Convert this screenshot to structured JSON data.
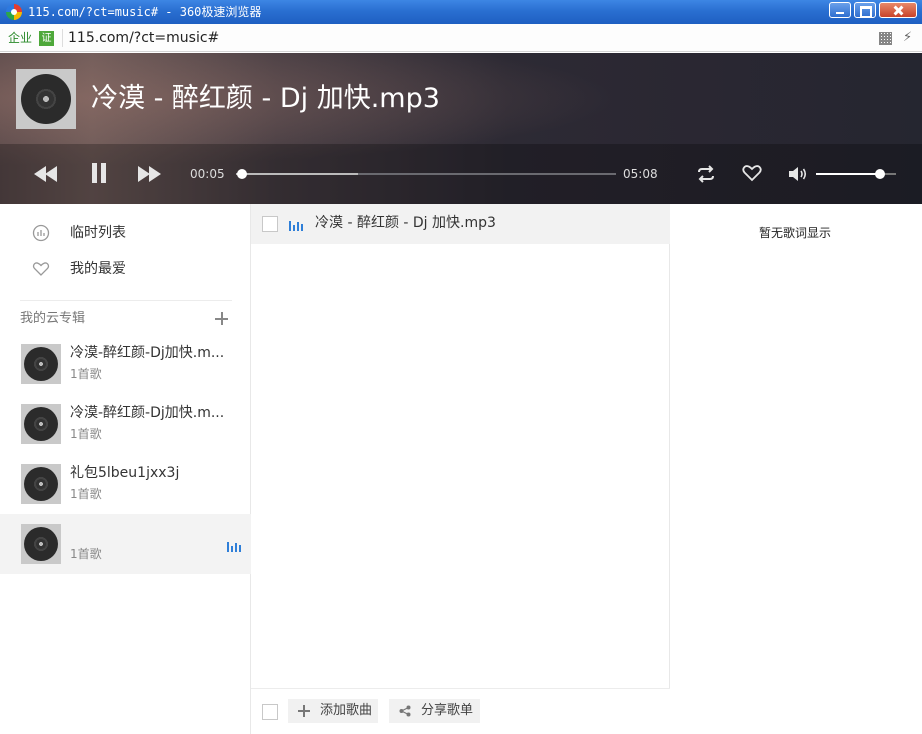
{
  "window": {
    "title": "115.com/?ct=music# - 360极速浏览器"
  },
  "address": {
    "cert_label": "企业",
    "cert_badge": "证",
    "url": "115.com/?ct=music#"
  },
  "player": {
    "title": "冷漠 - 醉红颜 - Dj 加快.mp3",
    "current_time": "00:05",
    "total_time": "05:08",
    "progress_fraction": 0.016,
    "buffered_fraction": 0.32,
    "volume_fraction": 0.8
  },
  "sidebar": {
    "nav": [
      {
        "label": "临时列表",
        "icon": "temp-list-icon"
      },
      {
        "label": "我的最爱",
        "icon": "heart-icon"
      }
    ],
    "albums_header": "我的云专辑",
    "albums": [
      {
        "name": "冷漠-醉红颜-Dj加快.m...",
        "count": "1首歌"
      },
      {
        "name": "冷漠-醉红颜-Dj加快.m...",
        "count": "1首歌"
      },
      {
        "name": "礼包5lbeu1jxx3j",
        "count": "1首歌"
      },
      {
        "name": "",
        "count": "1首歌"
      }
    ]
  },
  "tracklist": {
    "tracks": [
      {
        "title": "冷漠 - 醉红颜 - Dj 加快.mp3"
      }
    ],
    "add_label": "添加歌曲",
    "share_label": "分享歌单"
  },
  "lyrics": {
    "empty_message": "暂无歌词显示"
  },
  "colors": {
    "playing_accent": "#2f7fd8",
    "header_dark": "#2a2732"
  }
}
